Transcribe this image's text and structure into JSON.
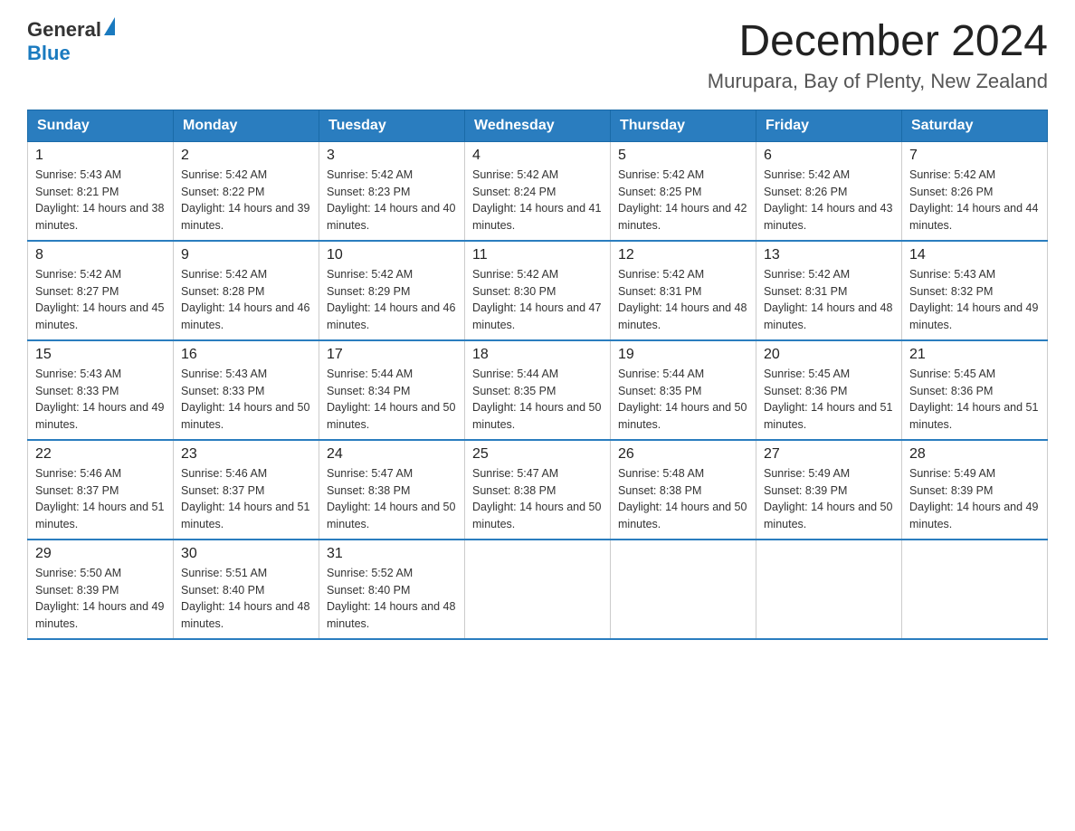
{
  "header": {
    "logo_general": "General",
    "logo_blue": "Blue",
    "title": "December 2024",
    "subtitle": "Murupara, Bay of Plenty, New Zealand"
  },
  "days_header": [
    "Sunday",
    "Monday",
    "Tuesday",
    "Wednesday",
    "Thursday",
    "Friday",
    "Saturday"
  ],
  "weeks": [
    [
      {
        "num": "1",
        "sunrise": "5:43 AM",
        "sunset": "8:21 PM",
        "daylight": "14 hours and 38 minutes."
      },
      {
        "num": "2",
        "sunrise": "5:42 AM",
        "sunset": "8:22 PM",
        "daylight": "14 hours and 39 minutes."
      },
      {
        "num": "3",
        "sunrise": "5:42 AM",
        "sunset": "8:23 PM",
        "daylight": "14 hours and 40 minutes."
      },
      {
        "num": "4",
        "sunrise": "5:42 AM",
        "sunset": "8:24 PM",
        "daylight": "14 hours and 41 minutes."
      },
      {
        "num": "5",
        "sunrise": "5:42 AM",
        "sunset": "8:25 PM",
        "daylight": "14 hours and 42 minutes."
      },
      {
        "num": "6",
        "sunrise": "5:42 AM",
        "sunset": "8:26 PM",
        "daylight": "14 hours and 43 minutes."
      },
      {
        "num": "7",
        "sunrise": "5:42 AM",
        "sunset": "8:26 PM",
        "daylight": "14 hours and 44 minutes."
      }
    ],
    [
      {
        "num": "8",
        "sunrise": "5:42 AM",
        "sunset": "8:27 PM",
        "daylight": "14 hours and 45 minutes."
      },
      {
        "num": "9",
        "sunrise": "5:42 AM",
        "sunset": "8:28 PM",
        "daylight": "14 hours and 46 minutes."
      },
      {
        "num": "10",
        "sunrise": "5:42 AM",
        "sunset": "8:29 PM",
        "daylight": "14 hours and 46 minutes."
      },
      {
        "num": "11",
        "sunrise": "5:42 AM",
        "sunset": "8:30 PM",
        "daylight": "14 hours and 47 minutes."
      },
      {
        "num": "12",
        "sunrise": "5:42 AM",
        "sunset": "8:31 PM",
        "daylight": "14 hours and 48 minutes."
      },
      {
        "num": "13",
        "sunrise": "5:42 AM",
        "sunset": "8:31 PM",
        "daylight": "14 hours and 48 minutes."
      },
      {
        "num": "14",
        "sunrise": "5:43 AM",
        "sunset": "8:32 PM",
        "daylight": "14 hours and 49 minutes."
      }
    ],
    [
      {
        "num": "15",
        "sunrise": "5:43 AM",
        "sunset": "8:33 PM",
        "daylight": "14 hours and 49 minutes."
      },
      {
        "num": "16",
        "sunrise": "5:43 AM",
        "sunset": "8:33 PM",
        "daylight": "14 hours and 50 minutes."
      },
      {
        "num": "17",
        "sunrise": "5:44 AM",
        "sunset": "8:34 PM",
        "daylight": "14 hours and 50 minutes."
      },
      {
        "num": "18",
        "sunrise": "5:44 AM",
        "sunset": "8:35 PM",
        "daylight": "14 hours and 50 minutes."
      },
      {
        "num": "19",
        "sunrise": "5:44 AM",
        "sunset": "8:35 PM",
        "daylight": "14 hours and 50 minutes."
      },
      {
        "num": "20",
        "sunrise": "5:45 AM",
        "sunset": "8:36 PM",
        "daylight": "14 hours and 51 minutes."
      },
      {
        "num": "21",
        "sunrise": "5:45 AM",
        "sunset": "8:36 PM",
        "daylight": "14 hours and 51 minutes."
      }
    ],
    [
      {
        "num": "22",
        "sunrise": "5:46 AM",
        "sunset": "8:37 PM",
        "daylight": "14 hours and 51 minutes."
      },
      {
        "num": "23",
        "sunrise": "5:46 AM",
        "sunset": "8:37 PM",
        "daylight": "14 hours and 51 minutes."
      },
      {
        "num": "24",
        "sunrise": "5:47 AM",
        "sunset": "8:38 PM",
        "daylight": "14 hours and 50 minutes."
      },
      {
        "num": "25",
        "sunrise": "5:47 AM",
        "sunset": "8:38 PM",
        "daylight": "14 hours and 50 minutes."
      },
      {
        "num": "26",
        "sunrise": "5:48 AM",
        "sunset": "8:38 PM",
        "daylight": "14 hours and 50 minutes."
      },
      {
        "num": "27",
        "sunrise": "5:49 AM",
        "sunset": "8:39 PM",
        "daylight": "14 hours and 50 minutes."
      },
      {
        "num": "28",
        "sunrise": "5:49 AM",
        "sunset": "8:39 PM",
        "daylight": "14 hours and 49 minutes."
      }
    ],
    [
      {
        "num": "29",
        "sunrise": "5:50 AM",
        "sunset": "8:39 PM",
        "daylight": "14 hours and 49 minutes."
      },
      {
        "num": "30",
        "sunrise": "5:51 AM",
        "sunset": "8:40 PM",
        "daylight": "14 hours and 48 minutes."
      },
      {
        "num": "31",
        "sunrise": "5:52 AM",
        "sunset": "8:40 PM",
        "daylight": "14 hours and 48 minutes."
      },
      null,
      null,
      null,
      null
    ]
  ]
}
